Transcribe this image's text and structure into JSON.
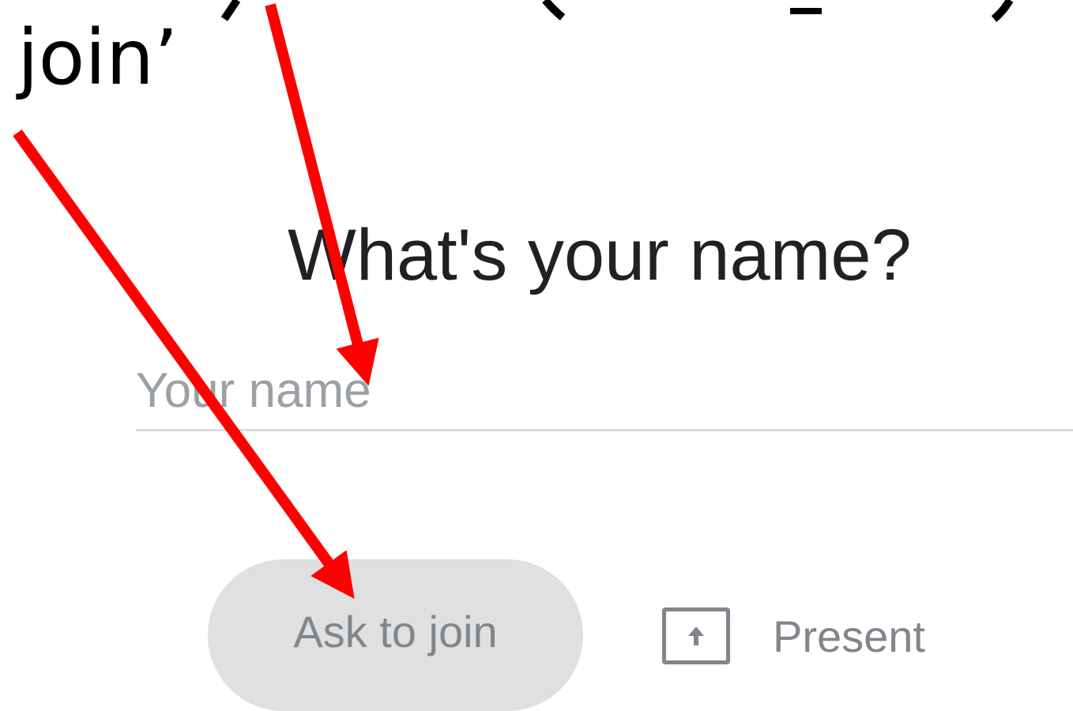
{
  "annotation": {
    "text": "join’"
  },
  "dialog": {
    "heading": "What's your name?",
    "name_input": {
      "value": "",
      "placeholder": "Your name"
    },
    "ask_button_label": "Ask to join",
    "present_label": "Present",
    "present_icon": "present-upload-icon"
  },
  "colors": {
    "arrow": "#ff0000",
    "button_bg": "#e0e0e0",
    "muted_text": "#80868b",
    "heading_text": "#202124"
  }
}
